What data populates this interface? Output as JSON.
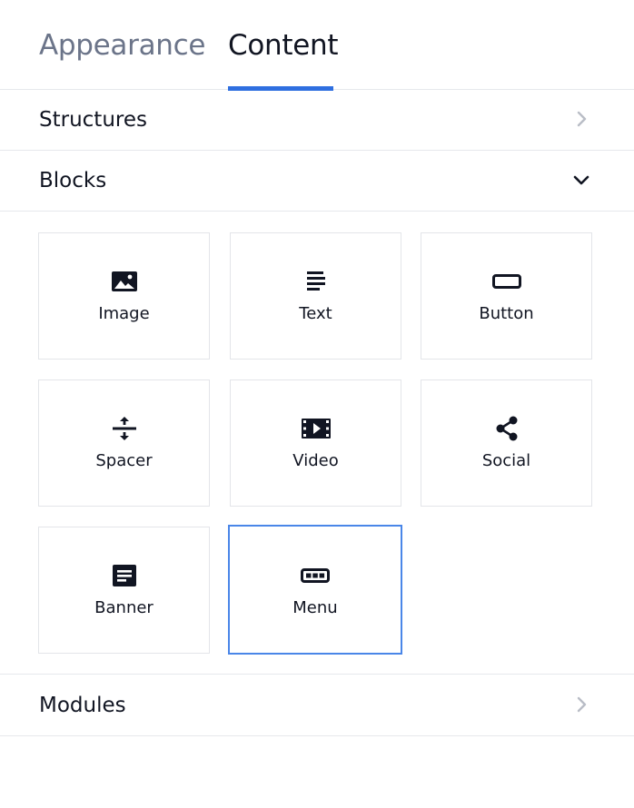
{
  "tabs": [
    {
      "label": "Appearance",
      "active": false
    },
    {
      "label": "Content",
      "active": true
    }
  ],
  "accent_color": "#2f6fe0",
  "sections": {
    "structures": {
      "label": "Structures",
      "state": "collapsed",
      "icon": "chevron-right-icon"
    },
    "blocks": {
      "label": "Blocks",
      "state": "expanded",
      "icon": "chevron-down-icon"
    },
    "modules": {
      "label": "Modules",
      "state": "collapsed",
      "icon": "chevron-right-icon"
    }
  },
  "blocks": [
    {
      "label": "Image",
      "icon": "image-icon"
    },
    {
      "label": "Text",
      "icon": "text-icon"
    },
    {
      "label": "Button",
      "icon": "button-icon"
    },
    {
      "label": "Spacer",
      "icon": "spacer-icon"
    },
    {
      "label": "Video",
      "icon": "video-icon"
    },
    {
      "label": "Social",
      "icon": "social-icon"
    },
    {
      "label": "Banner",
      "icon": "banner-icon"
    },
    {
      "label": "Menu",
      "icon": "menu-icon",
      "selected": true
    }
  ]
}
